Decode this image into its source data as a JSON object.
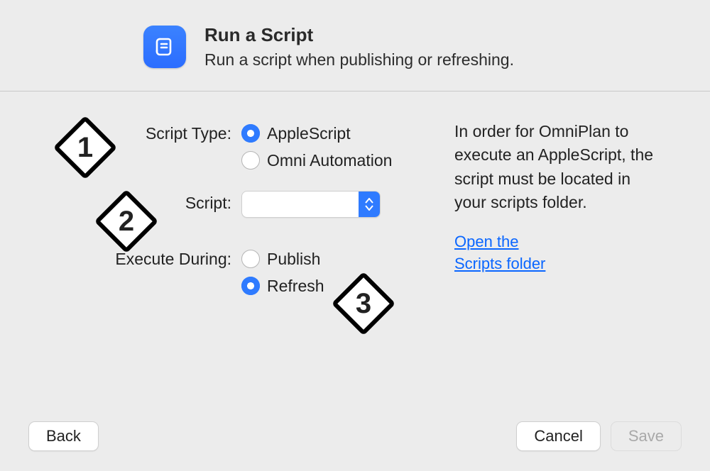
{
  "header": {
    "title": "Run a Script",
    "subtitle": "Run a script when publishing or refreshing."
  },
  "labels": {
    "script_type": "Script Type:",
    "script": "Script:",
    "execute_during": "Execute During:"
  },
  "script_type": {
    "options": [
      "AppleScript",
      "Omni Automation"
    ],
    "selected": "AppleScript"
  },
  "script_select": {
    "value": ""
  },
  "execute_during": {
    "options": [
      "Publish",
      "Refresh"
    ],
    "selected": "Refresh"
  },
  "help": {
    "text": "In order for OmniPlan to execute an AppleScript, the script must be located in your scripts folder.",
    "link_line1": "Open the",
    "link_line2": "Scripts folder"
  },
  "badges": {
    "b1": "1",
    "b2": "2",
    "b3": "3"
  },
  "footer": {
    "back": "Back",
    "cancel": "Cancel",
    "save": "Save"
  },
  "colors": {
    "accent": "#2f7bff",
    "link": "#0a66ff",
    "bg": "#ececec"
  }
}
